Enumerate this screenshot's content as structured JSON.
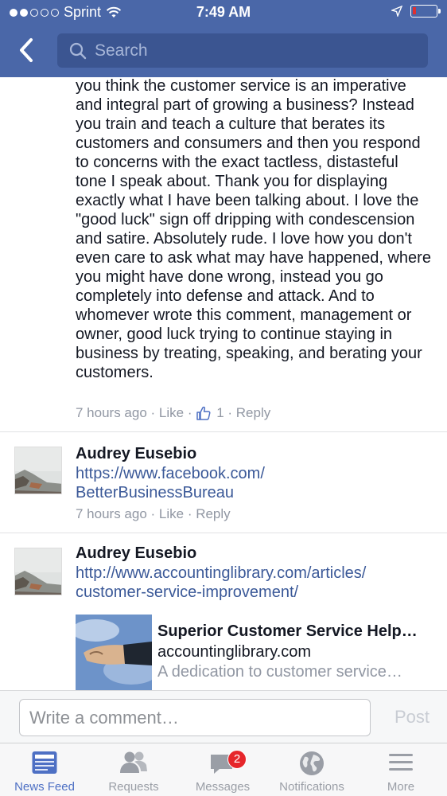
{
  "status_bar": {
    "carrier": "Sprint",
    "time": "7:49 AM"
  },
  "search": {
    "placeholder": "Search"
  },
  "comments": [
    {
      "text": "you think the customer service is an imperative and integral part of growing a business? Instead you train and teach a culture that berates its customers and consumers and then you respond to concerns with the exact tactless, distasteful tone I speak about. Thank you for displaying exactly what I have been talking about. I love the \"good luck\" sign off dripping with condescension and satire. Absolutely rude. I love how you don't even care to ask what may have happened, where you might have done wrong, instead you go completely into defense and attack. And to whomever wrote this comment, management or owner, good luck trying to continue staying in business by treating, speaking, and berating your customers.",
      "time": "7 hours ago",
      "like": "Like",
      "like_count": "1",
      "reply": "Reply"
    },
    {
      "author": "Audrey Eusebio",
      "url_line1": "https://www.facebook.com/",
      "url_line2": "BetterBusinessBureau",
      "time": "7 hours ago",
      "like": "Like",
      "reply": "Reply"
    },
    {
      "author": "Audrey Eusebio",
      "url_line1": "http://www.accountinglibrary.com/articles/",
      "url_line2": "customer-service-improvement/",
      "preview": {
        "title": "Superior Customer Service Help…",
        "domain": "accountinglibrary.com",
        "description": "A dedication to customer service…"
      }
    }
  ],
  "composer": {
    "placeholder": "Write a comment…",
    "post_label": "Post"
  },
  "tabs": [
    {
      "label": "News Feed",
      "icon": "news-feed-icon",
      "active": true
    },
    {
      "label": "Requests",
      "icon": "friend-requests-icon"
    },
    {
      "label": "Messages",
      "icon": "messages-icon",
      "badge": "2"
    },
    {
      "label": "Notifications",
      "icon": "globe-icon"
    },
    {
      "label": "More",
      "icon": "hamburger-menu-icon"
    }
  ],
  "colors": {
    "header": "#4a67a8",
    "link": "#3b5998",
    "active_tab": "#4e70c4",
    "badge": "#e6262b"
  }
}
